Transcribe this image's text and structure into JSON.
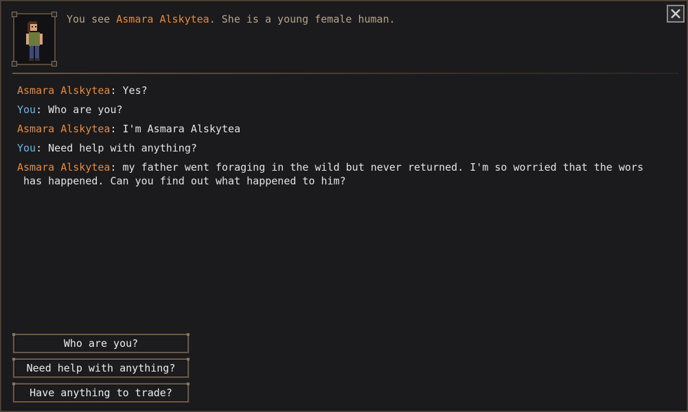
{
  "header": {
    "examine_prefix": "You see ",
    "npc_name": "Asmara Alskytea",
    "examine_suffix": ". She is a young female human."
  },
  "close_icon": "close-icon",
  "dialog": [
    {
      "speaker": "Asmara Alskytea",
      "who": "npc",
      "text": "Yes?"
    },
    {
      "speaker": "You",
      "who": "player",
      "text": "Who are you?"
    },
    {
      "speaker": "Asmara Alskytea",
      "who": "npc",
      "text": "I'm Asmara Alskytea"
    },
    {
      "speaker": "You",
      "who": "player",
      "text": "Need help with anything?"
    },
    {
      "speaker": "Asmara Alskytea",
      "who": "npc",
      "text_line1": "my father went foraging in the wild but never returned. I'm so worried that the wors",
      "text_line2": " has happened. Can you find out what happened to him?"
    }
  ],
  "options": [
    {
      "label": "Who are you?"
    },
    {
      "label": "Need help with anything?"
    },
    {
      "label": "Have anything to trade?"
    }
  ],
  "colors": {
    "npc_name": "#e88a3e",
    "player_name": "#6ab7ec",
    "background": "#1b1b1d",
    "frame": "#6a5848"
  }
}
